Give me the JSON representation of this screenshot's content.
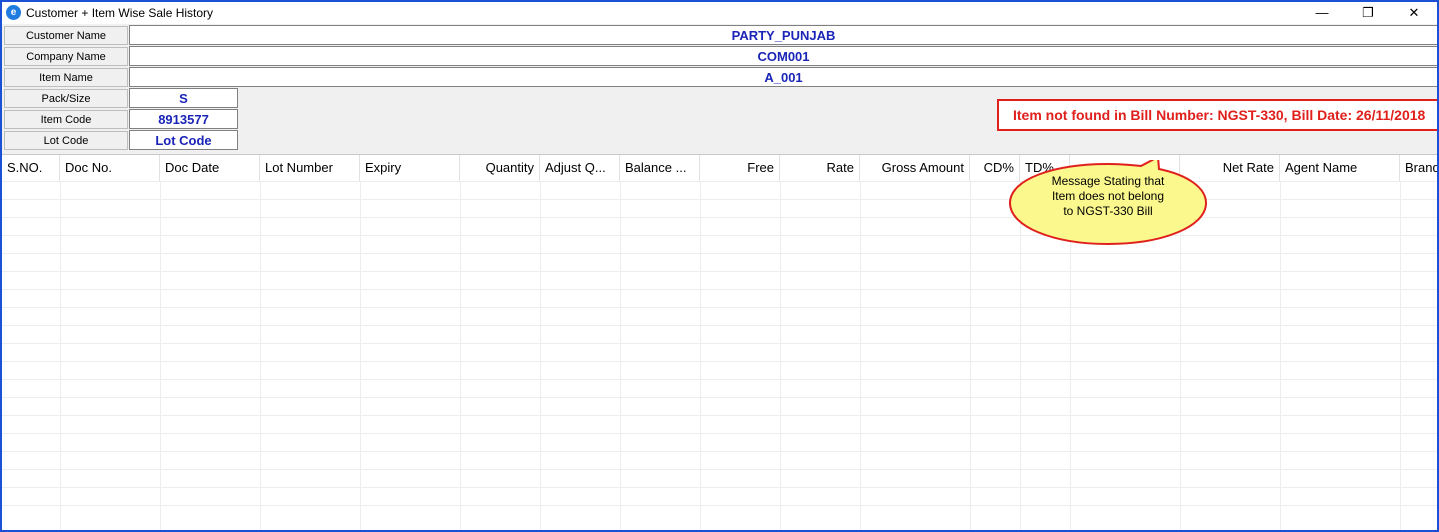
{
  "window": {
    "title": "Customer + Item Wise Sale History",
    "minimize_glyph": "—",
    "restore_glyph": "❐",
    "close_glyph": "✕"
  },
  "form": {
    "customer_name_label": "Customer Name",
    "customer_name_value": "PARTY_PUNJAB",
    "company_name_label": "Company Name",
    "company_name_value": "COM001",
    "item_name_label": "Item Name",
    "item_name_value": "A_001",
    "pack_size_label": "Pack/Size",
    "pack_size_value": "S",
    "item_code_label": "Item Code",
    "item_code_value": "8913577",
    "lot_code_label": "Lot Code",
    "lot_code_value": "Lot Code"
  },
  "alert": {
    "message": "Item not found in Bill Number: NGST-330, Bill Date: 26/11/2018"
  },
  "callout": {
    "line1": "Message Stating that",
    "line2": "Item does not belong",
    "line3": "to NGST-330 Bill"
  },
  "grid": {
    "columns": [
      "S.NO.",
      "Doc No.",
      "Doc Date",
      "Lot Number",
      "Expiry",
      "Quantity",
      "Adjust Q...",
      "Balance ...",
      "Free",
      "Rate",
      "Gross Amount",
      "CD%",
      "TD%",
      "",
      "Net Rate",
      "Agent Name",
      "Brand"
    ]
  }
}
